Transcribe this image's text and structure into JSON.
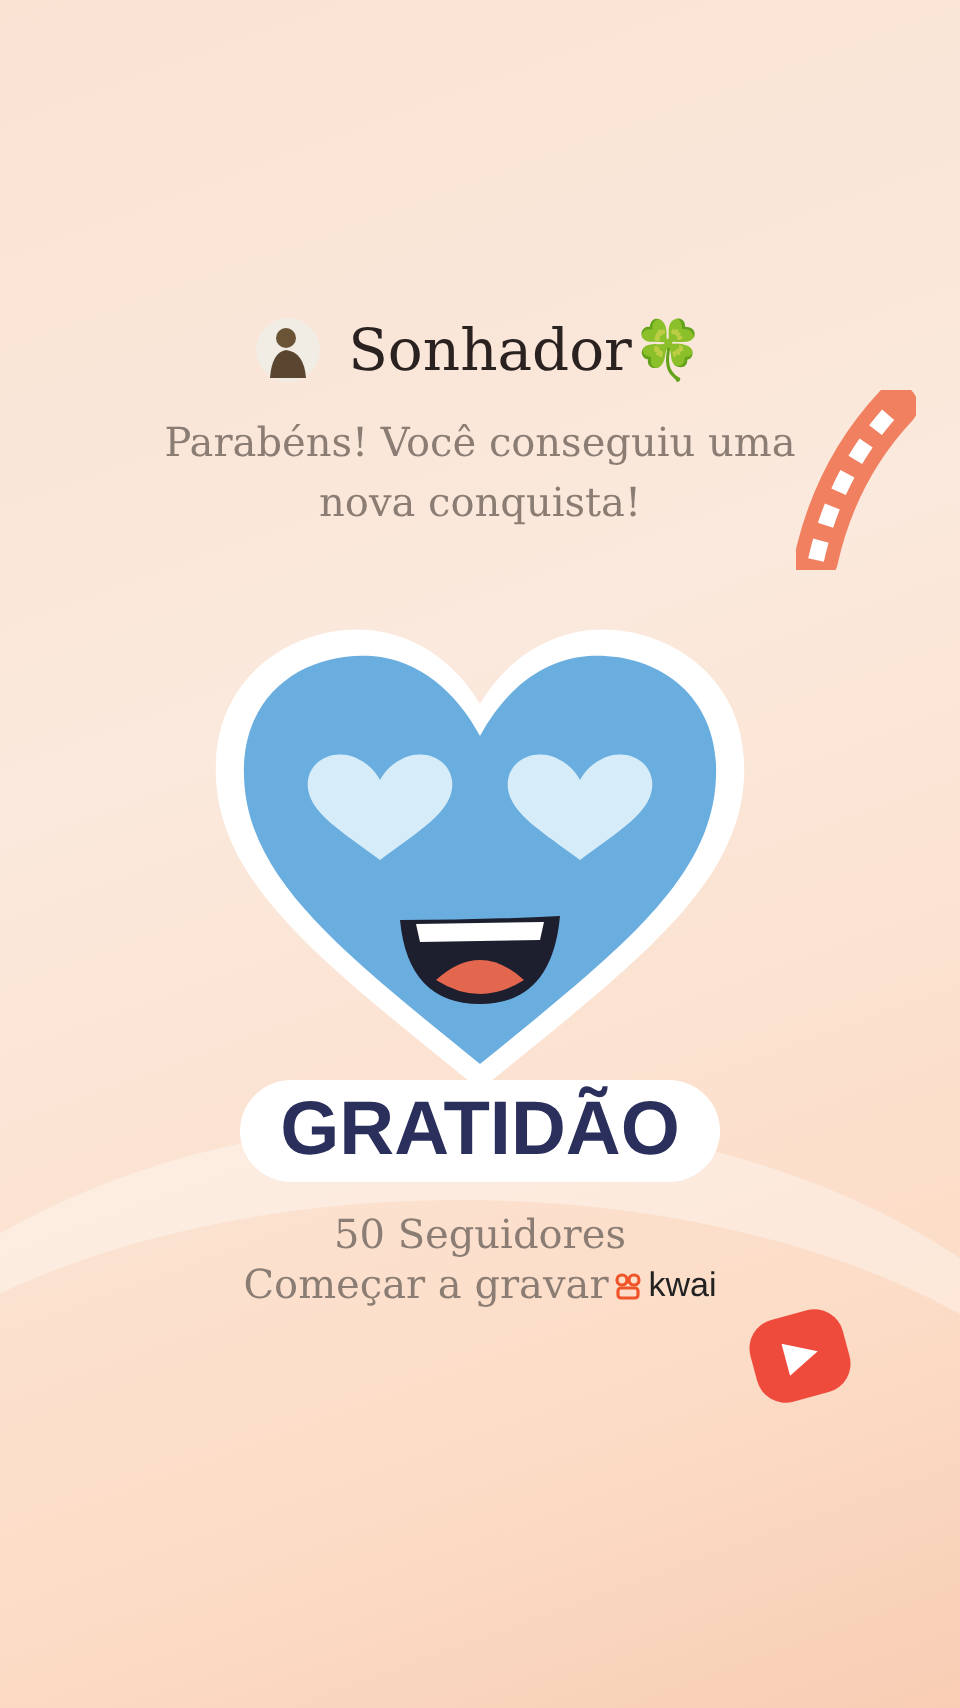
{
  "user": {
    "name": "Sonhador🍀"
  },
  "message": "Parabéns! Você conseguiu uma nova conquista!",
  "sticker": {
    "label": "GRATIDÃO"
  },
  "followers": "50 Seguidores",
  "cta": {
    "text": "Começar a gravar",
    "brand": "kwai"
  }
}
